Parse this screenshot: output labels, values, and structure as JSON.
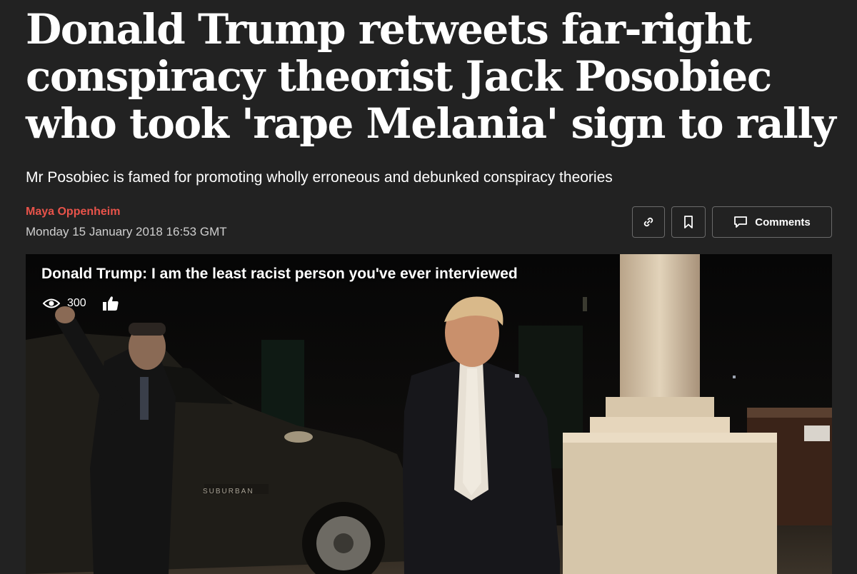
{
  "article": {
    "headline": "Donald Trump retweets far-right conspiracy theorist Jack Posobiec who took 'rape Melania' sign to rally",
    "standfirst": "Mr Posobiec is famed for promoting wholly erroneous and debunked conspiracy theories",
    "author": "Maya Oppenheim",
    "date": "Monday 15 January 2018 16:53 GMT"
  },
  "actions": {
    "link_icon": "link-icon",
    "bookmark_icon": "bookmark-icon",
    "comments_icon": "comment-icon",
    "comments_label": "Comments"
  },
  "video": {
    "title": "Donald Trump: I am the least racist person you've ever interviewed",
    "views": "300",
    "views_icon": "eye-icon",
    "like_icon": "thumbs-up-icon",
    "vehicle_badge": "SUBURBAN"
  },
  "colors": {
    "background": "#222222",
    "author": "#e8534a",
    "button_border": "#6a6a6a"
  }
}
